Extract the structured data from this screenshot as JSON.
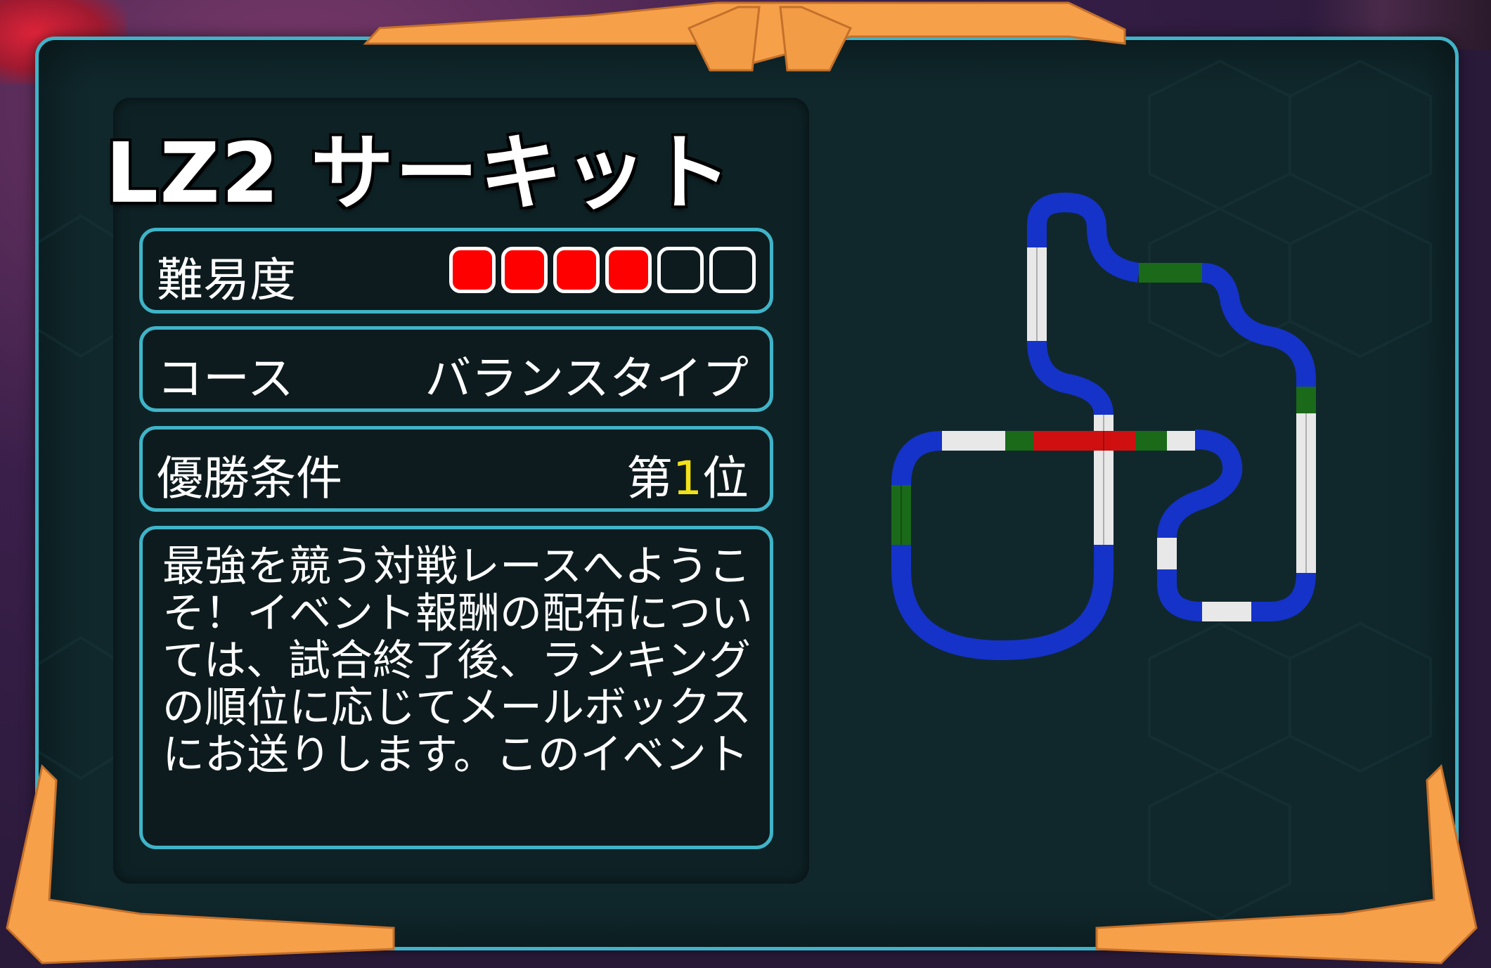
{
  "event": {
    "title": "LZ2 サーキット"
  },
  "info": {
    "difficulty_label": "難易度",
    "difficulty_level": 4,
    "difficulty_max": 6,
    "difficulty_on_color": "#ff0000",
    "difficulty_off_color": "#0d1b1e",
    "course_label": "コース",
    "course_value": "バランスタイプ",
    "win_label": "優勝条件",
    "win_prefix": "第",
    "win_rank": "1",
    "win_suffix": "位"
  },
  "description": {
    "text": "最強を競う対戦レースへようこそ！イベント報酬の配布については、試合終了後、ランキングの順位に応じてメールボックスにお送りします。このイベント"
  },
  "colors": {
    "frame_border": "#3fb4c8",
    "accent_orange": "#f7a04a",
    "track_blue": "#1533c8",
    "track_white": "#e8e8e8",
    "track_green": "#1a6a1a",
    "track_red": "#d01010"
  }
}
